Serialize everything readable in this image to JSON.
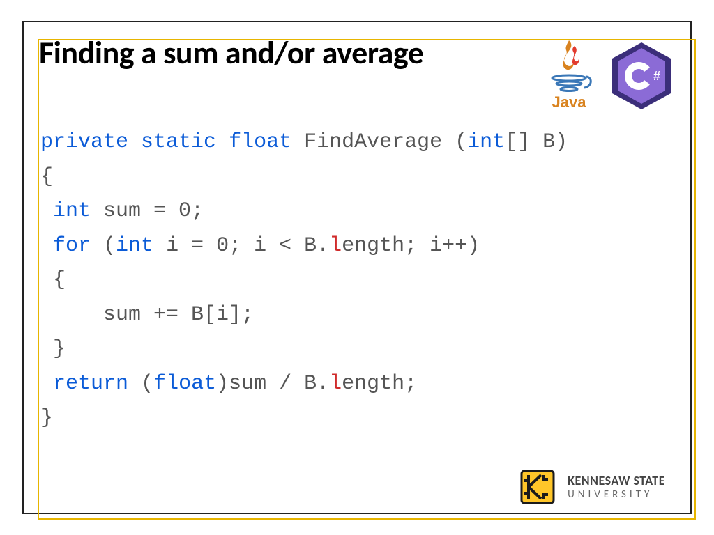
{
  "title": "Finding a sum and/or average",
  "icons": {
    "java_label": "Java",
    "csharp_label": "C#"
  },
  "code": {
    "l1_kw1": "private",
    "l1_kw2": "static",
    "l1_kw3": "float",
    "l1_fn": " FindAverage (",
    "l1_kw4": "int",
    "l1_tail": "[] B)",
    "l2": "{",
    "l3_kw": "int",
    "l3_rest": " sum = 0;",
    "l4_kw1": "for",
    "l4_p1": " (",
    "l4_kw2": "int",
    "l4_p2": " i = 0; i < B.",
    "l4_l": "l",
    "l4_p3": "ength; i++)",
    "l5": " {",
    "l6": "     sum += B[i];",
    "l7": " }",
    "l8_kw1": "return",
    "l8_p1": " (",
    "l8_kw2": "float",
    "l8_p2": ")sum / B.",
    "l8_l": "l",
    "l8_p3": "ength;",
    "l9": "}"
  },
  "footer": {
    "line1": "KENNESAW STATE",
    "line2": "UNIVERSITY"
  }
}
